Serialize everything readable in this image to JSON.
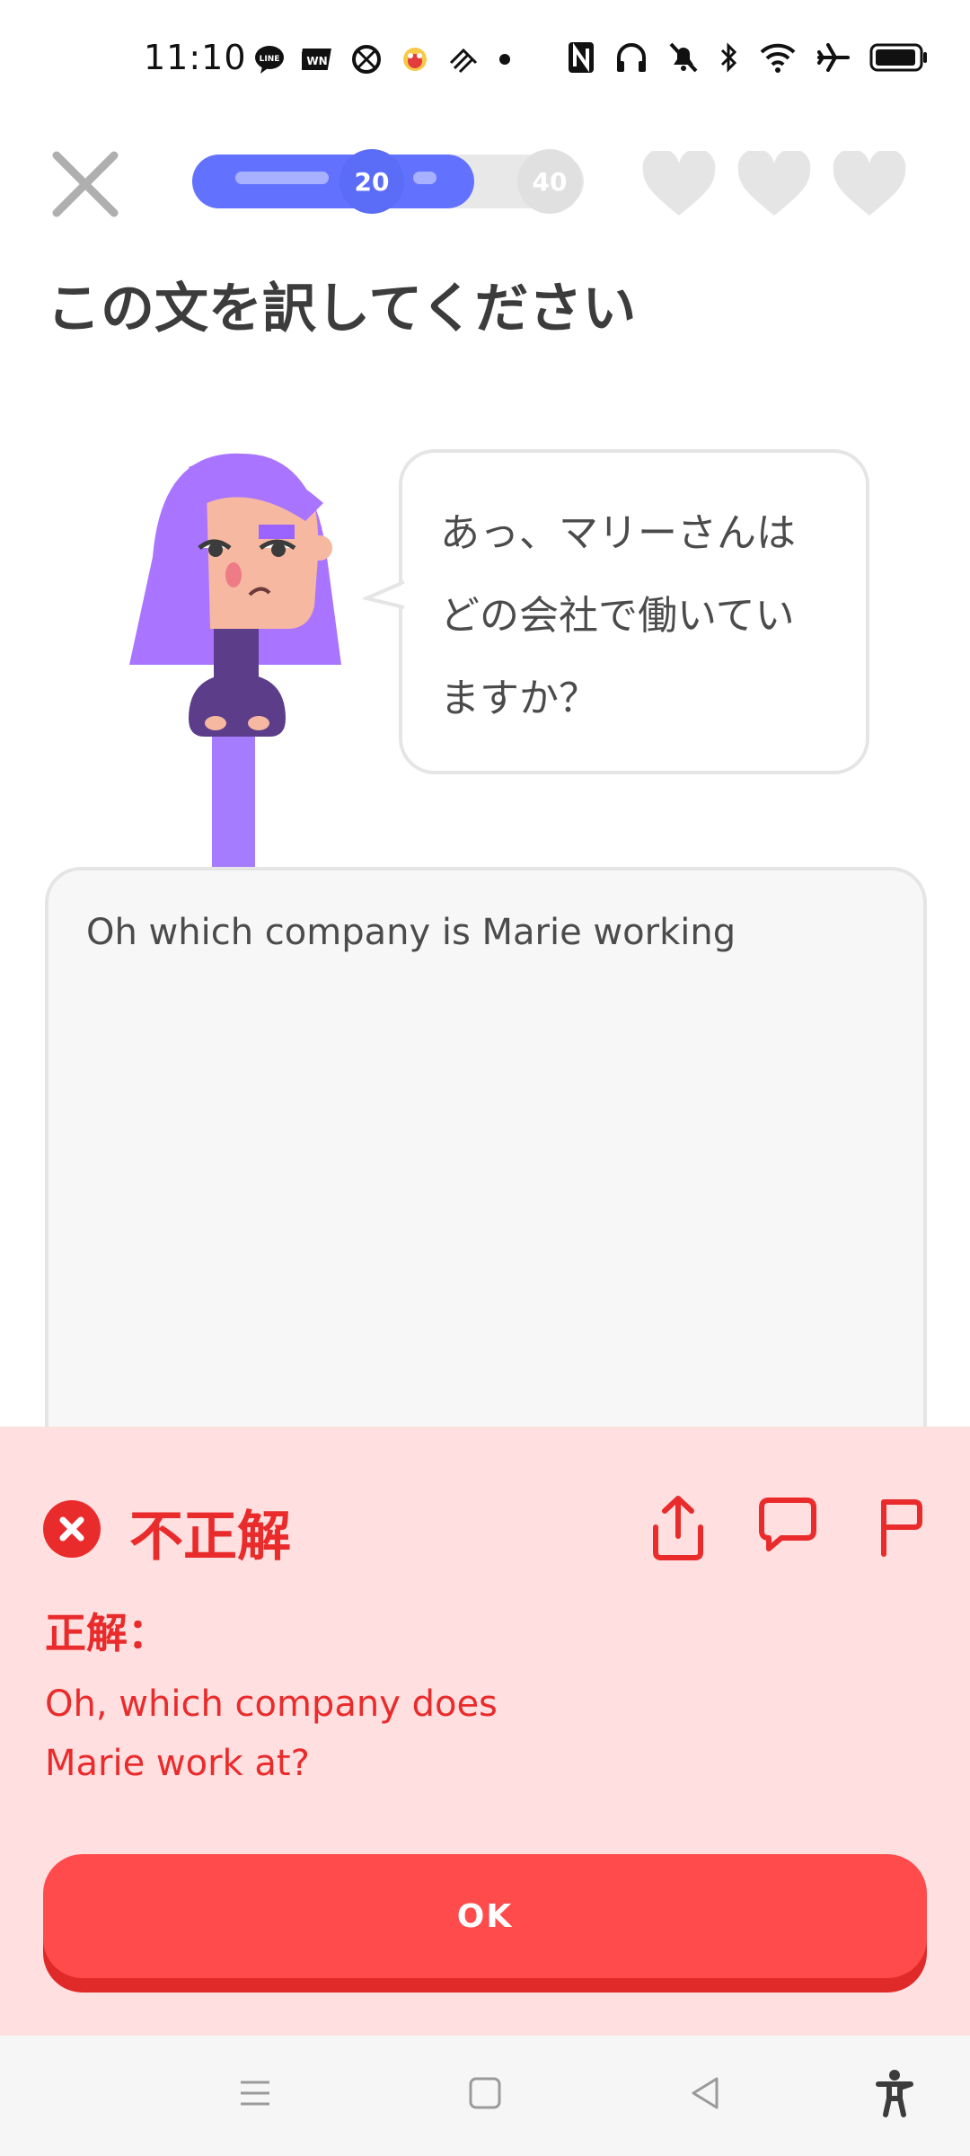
{
  "status_bar": {
    "time": "11:10",
    "app_icons": [
      "line-icon",
      "wn-icon",
      "app-icon",
      "mascot-icon",
      "app-icon-2",
      "dot-icon"
    ],
    "system_icons": [
      "nfc-icon",
      "headphones-icon",
      "mute-icon",
      "bluetooth-icon",
      "wifi-icon",
      "airplane-icon",
      "battery-icon"
    ]
  },
  "progress": {
    "fraction": 0.72,
    "milestones": [
      "20",
      "40"
    ]
  },
  "hearts": {
    "count": 3
  },
  "prompt": {
    "title": "この文を訳してください"
  },
  "speech": {
    "lines": [
      "あっ、マリーさんは",
      "どの会社で働いてい",
      "ますか？"
    ]
  },
  "answer": {
    "text": "Oh which company is Marie working"
  },
  "feedback": {
    "title": "不正解",
    "label": "正解：",
    "correct_lines": [
      "Oh, which company does",
      "Marie work at?"
    ],
    "button": "OK"
  },
  "colors": {
    "accent": "#6272ff",
    "error": "#ea2b2b",
    "feedback_bg": "#ffdfe0",
    "ok_button": "#ff4b4b"
  },
  "navbar": {
    "icons": [
      "menu-icon",
      "home-icon",
      "back-icon",
      "accessibility-icon"
    ]
  }
}
